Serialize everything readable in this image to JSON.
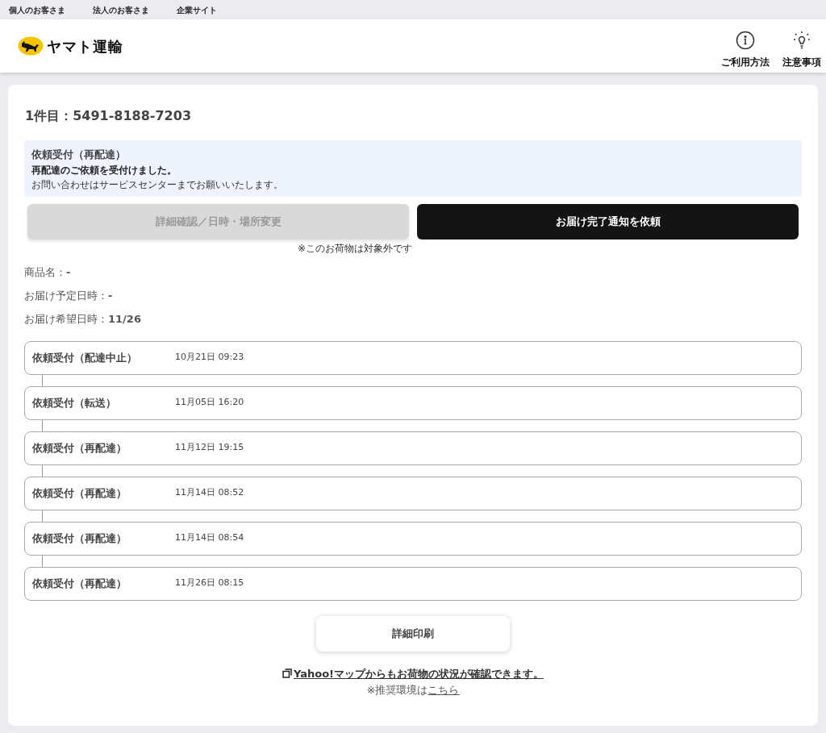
{
  "top_links": [
    "個人のお客さま",
    "法人のお客さま",
    "企業サイト"
  ],
  "header": {
    "logo_text": "ヤマト運輸",
    "actions": [
      {
        "kind": "info",
        "label": "ご利用方法"
      },
      {
        "kind": "bulb",
        "label": "注意事項"
      }
    ]
  },
  "parcel": {
    "title": "1件目：5491-8188-7203",
    "status": {
      "title": "依頼受付（再配達）",
      "message": "再配達のご依頼を受付けました。",
      "note": "お問い合わせはサービスセンターまでお願いいたします。"
    },
    "buttons": [
      {
        "label": "詳細確認／日時・場所変更",
        "disabled": true,
        "note": "※このお荷物は対象外です"
      },
      {
        "label": "お届け完了通知を依頼",
        "disabled": false
      }
    ],
    "fields": [
      "商品名：**-**",
      "お届け予定日時：**-**",
      "お届け希望日時：**11/26**"
    ],
    "history": [
      {
        "status": "依頼受付（配達中止）",
        "time": "10月21日 09:23"
      },
      {
        "status": "依頼受付（転送）",
        "time": "11月05日 16:20"
      },
      {
        "status": "依頼受付（再配達）",
        "time": "11月12日 19:15"
      },
      {
        "status": "依頼受付（再配達）",
        "time": "11月14日 08:52"
      },
      {
        "status": "依頼受付（再配達）",
        "time": "11月14日 08:54"
      },
      {
        "status": "依頼受付（再配達）",
        "time": "11月26日 08:15"
      }
    ],
    "print_button": "詳細印刷",
    "map_link": "Yahoo!マップからもお荷物の状況が確認できます。",
    "env_text": "※推奨環境は",
    "env_link": "こちら"
  }
}
